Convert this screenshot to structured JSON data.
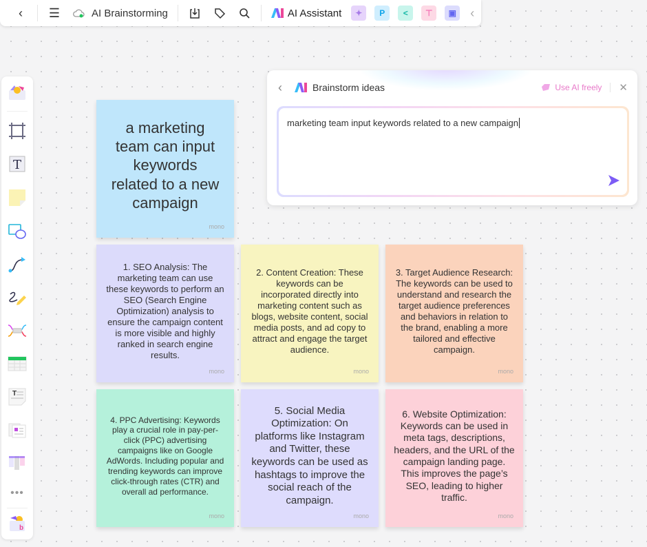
{
  "topbar": {
    "title": "AI Brainstorming",
    "ai_assistant": "AI Assistant",
    "apps": [
      {
        "name": "image-gen",
        "color": "#e6d4fb"
      },
      {
        "name": "presentation",
        "color": "#cfeefe",
        "glyph": "P"
      },
      {
        "name": "mindmap",
        "color": "#c8f5ec"
      },
      {
        "name": "flowchart",
        "color": "#fdd9e5"
      },
      {
        "name": "chat",
        "color": "#dcdcfd"
      }
    ]
  },
  "panel": {
    "title": "Brainstorm ideas",
    "use_ai": "Use AI freely",
    "input_value": "marketing team input keywords related to a new campaign"
  },
  "notes": [
    {
      "text": "a marketing team can input keywords related to a new campaign",
      "color": "#bfe6fb",
      "tag": "mono"
    },
    {
      "text": "1. SEO Analysis: The marketing team can use these keywords to perform an SEO (Search Engine Optimization) analysis to ensure the campaign content is more visible and highly ranked in search engine results.",
      "color": "#dcdbfb",
      "tag": "mono"
    },
    {
      "text": "2. Content Creation: These keywords can be incorporated directly into marketing content such as blogs, website content, social media posts, and ad copy to attract and engage the target audience.",
      "color": "#f8f4c0",
      "tag": "mono"
    },
    {
      "text": "3. Target Audience Research: The keywords can be used to understand and research the target audience preferences and behaviors in relation to the brand, enabling a more tailored and effective campaign.",
      "color": "#fbd3bc",
      "tag": "mono"
    },
    {
      "text": "4. PPC Advertising: Keywords play a crucial role in pay-per-click (PPC) advertising campaigns like on Google AdWords. Including popular and trending keywords can improve click-through rates (CTR) and overall ad performance.",
      "color": "#b5f1db",
      "tag": "mono"
    },
    {
      "text": "5. Social Media Optimization: On platforms like Instagram and Twitter, these keywords can be used as hashtags to improve the social reach of the campaign.",
      "color": "#dedcfd",
      "tag": "mono"
    },
    {
      "text": "6. Website Optimization: Keywords can be used in meta tags, descriptions, headers, and the URL of the campaign landing page. This improves the page’s SEO, leading to higher traffic.",
      "color": "#fdd1d9",
      "tag": "mono"
    }
  ],
  "sidebar": [
    "templates",
    "frame",
    "text",
    "sticky-note",
    "shapes",
    "connector",
    "pen",
    "mindmap",
    "table",
    "text-doc",
    "cards",
    "kanban",
    "more",
    "plugins"
  ]
}
